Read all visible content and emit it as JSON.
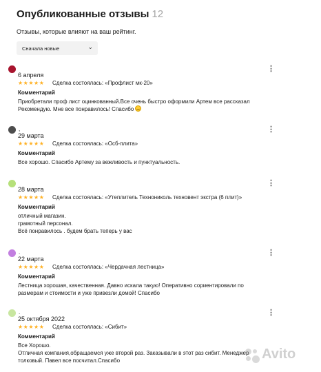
{
  "header": {
    "title": "Опубликованные отзывы",
    "count": "12"
  },
  "subtitle": "Отзывы, которые влияют на ваш рейтинг.",
  "sort": {
    "selected": "Сначала новые"
  },
  "stars_glyph": "★★★★★",
  "rating_color": "#ffb021",
  "reviews": [
    {
      "avatar_color": "#a8142e",
      "author": "",
      "date": "6 апреля",
      "rating": 5,
      "deal": "Сделка состоялась: «Профлист мк-20»",
      "comment_label": "Комментарий",
      "lines": [
        "Приобретали проф лист оцинкованный.Все очень быстро оформили Артем все рассказал",
        " Рекомендую. Мне все понравилось! Спасибо"
      ]
    },
    {
      "avatar_color": "#4d4d4d",
      "author": ",",
      "date": "29 марта",
      "rating": 5,
      "deal": "Сделка состоялась: «Осб-плита»",
      "comment_label": "Комментарий",
      "lines": [
        "Все хорошо. Спасибо Артему за вежливость и пунктуальность."
      ]
    },
    {
      "avatar_color": "#b6e07a",
      "author": "",
      "date": "28 марта",
      "rating": 5,
      "deal": "Сделка состоялась: «Утеплитель Технониколь техновент экстра (6 плит)»",
      "comment_label": "Комментарий",
      "lines": [
        "отличный магазин.",
        "грамотный персонал.",
        "Всё понравилось . будем брать теперь у вас"
      ]
    },
    {
      "avatar_color": "#c27fe0",
      "author": ".",
      "date": "22 марта",
      "rating": 5,
      "deal": "Сделка состоялась: «Чердачная лестница»",
      "comment_label": "Комментарий",
      "lines": [
        "Лестница хорошая, качественная. Давно искала такую! Оперативно сориентировали по",
        "размерам и стоимости и уже привезли домой! Спасибо"
      ]
    },
    {
      "avatar_color": "#c8e6a0",
      "author": ".",
      "date": "25 октября 2022",
      "rating": 5,
      "deal": "Сделка состоялась: «Сибит»",
      "comment_label": "Комментарий",
      "lines": [
        "Все Хорошо.",
        "Отличная компания,обращаемся уже второй раз. Заказывали в этот раз сибит. Менеджер",
        "толковый. Павел все посчитал.Спасибо"
      ]
    }
  ],
  "watermark": {
    "text": "Avito"
  }
}
